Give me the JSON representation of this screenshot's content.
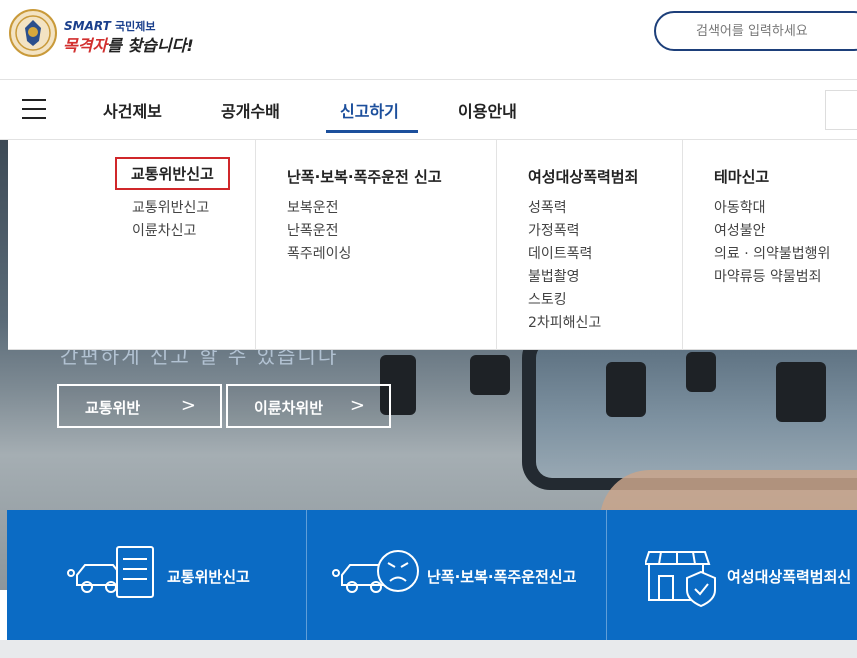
{
  "header": {
    "logo_small_en": "SMART",
    "logo_small_ko": "국민제보",
    "logo_big_red": "목격자",
    "logo_big_rest": "를 찾습니다!",
    "search_placeholder": "검색어를 입력하세요"
  },
  "nav": {
    "items": [
      {
        "label": "사건제보"
      },
      {
        "label": "공개수배"
      },
      {
        "label": "신고하기"
      },
      {
        "label": "이용안내"
      }
    ],
    "active": "신고하기"
  },
  "mega_menu": {
    "columns": [
      {
        "title": "교통위반신고",
        "items": [
          "교통위반신고",
          "이륜차신고"
        ]
      },
      {
        "title": "난폭·보복·폭주운전 신고",
        "items": [
          "보복운전",
          "난폭운전",
          "폭주레이싱"
        ]
      },
      {
        "title": "여성대상폭력범죄",
        "items": [
          "성폭력",
          "가정폭력",
          "데이트폭력",
          "불법촬영",
          "스토킹",
          "2차피해신고"
        ]
      },
      {
        "title": "테마신고",
        "items": [
          "아동학대",
          "여성불안",
          "의료 · 의약불법행위",
          "마약류등 약물범죄"
        ]
      }
    ]
  },
  "hero": {
    "subtitle": "간편하게 신고 할 수 있습니다",
    "buttons": [
      {
        "label": "교통위반",
        "chevron": ">"
      },
      {
        "label": "이륜차위반",
        "chevron": ">"
      }
    ]
  },
  "strip": {
    "cells": [
      {
        "label": "교통위반신고",
        "icon": "traffic-report-icon"
      },
      {
        "label": "난폭·보복·폭주운전신고",
        "icon": "angry-driver-icon"
      },
      {
        "label": "여성대상폭력범죄신",
        "icon": "shop-shield-icon"
      }
    ]
  },
  "colors": {
    "brand_blue": "#1c4f9c",
    "strip_blue": "#0b6bc4",
    "highlight_red": "#d0272a"
  }
}
